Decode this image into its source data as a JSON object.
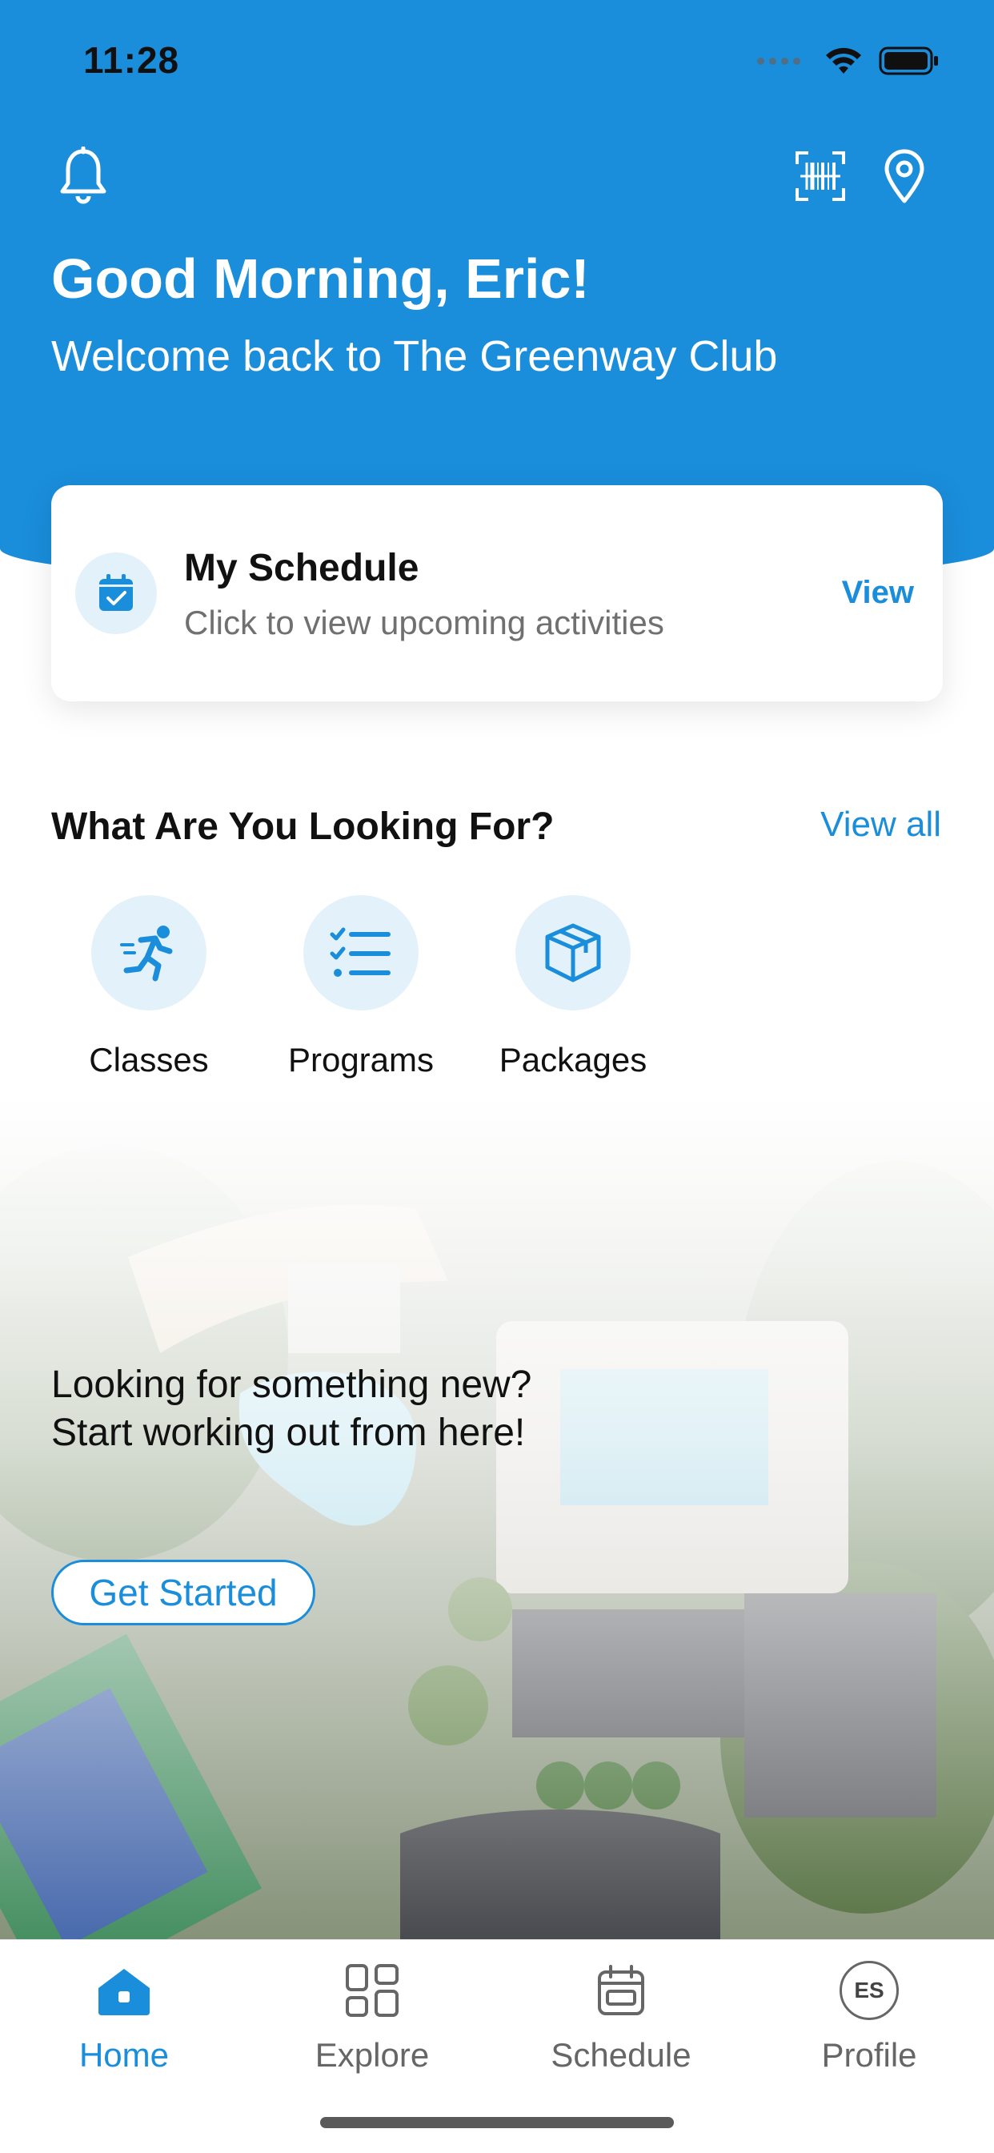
{
  "status_bar": {
    "time": "11:28"
  },
  "header": {
    "greeting": "Good Morning, Eric!",
    "welcome": "Welcome back to The Greenway Club",
    "icons": [
      "bell-icon",
      "barcode-scan-icon",
      "location-pin-icon"
    ],
    "background_color": "#1a8ddb"
  },
  "schedule_card": {
    "title": "My Schedule",
    "subtitle": "Click to view upcoming activities",
    "action": "View"
  },
  "looking_for": {
    "title": "What Are You Looking For?",
    "view_all": "View all",
    "items": [
      {
        "label": "Classes",
        "icon": "running-icon"
      },
      {
        "label": "Programs",
        "icon": "checklist-icon"
      },
      {
        "label": "Packages",
        "icon": "package-box-icon"
      }
    ]
  },
  "promo": {
    "line1": "Looking for something new?",
    "line2": "Start working out from here!",
    "button": "Get Started"
  },
  "tabbar": {
    "tabs": [
      {
        "label": "Home",
        "icon": "home-icon",
        "active": true
      },
      {
        "label": "Explore",
        "icon": "grid-icon",
        "active": false
      },
      {
        "label": "Schedule",
        "icon": "calendar-icon",
        "active": false
      },
      {
        "label": "Profile",
        "icon": "avatar-initials",
        "initials": "ES",
        "active": false
      }
    ],
    "accent_color": "#1a8ddb"
  }
}
